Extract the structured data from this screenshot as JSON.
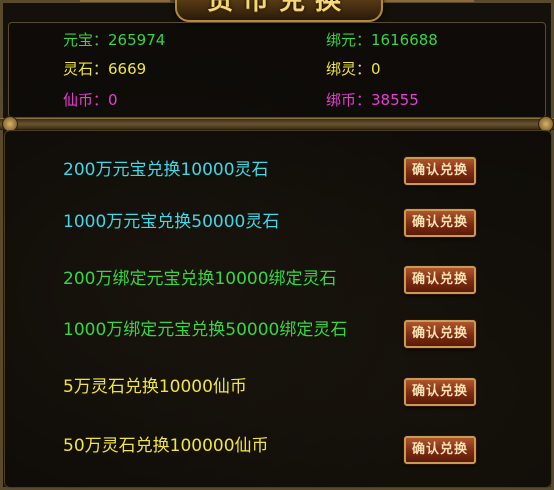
{
  "title": "货币兑换",
  "colors": {
    "cyan": "#3fd7e6",
    "green": "#36d640",
    "yellow": "#f1e43a",
    "magenta": "#e63ed2"
  },
  "currencies": [
    {
      "label": "元宝：",
      "value": "265974",
      "color": "#36d640"
    },
    {
      "label": "绑元：",
      "value": "1616688",
      "color": "#36d640"
    },
    {
      "label": "灵石：",
      "value": "6669",
      "color": "#f1e43a"
    },
    {
      "label": "绑灵：",
      "value": "0",
      "color": "#f1e43a"
    },
    {
      "label": "仙币：",
      "value": "0",
      "color": "#e63ed2"
    },
    {
      "label": "绑币：",
      "value": "38555",
      "color": "#e63ed2"
    }
  ],
  "exchanges": [
    {
      "text": "200万元宝兑换10000灵石",
      "color": "#3fd7e6",
      "button": "确认兑换"
    },
    {
      "text": "1000万元宝兑换50000灵石",
      "color": "#3fd7e6",
      "button": "确认兑换"
    },
    {
      "text": "200万绑定元宝兑换10000绑定灵石",
      "color": "#36d640",
      "button": "确认兑换"
    },
    {
      "text": "1000万绑定元宝兑换50000绑定灵石",
      "color": "#36d640",
      "button": "确认兑换"
    },
    {
      "text": "5万灵石兑换10000仙币",
      "color": "#f1e43a",
      "button": "确认兑换"
    },
    {
      "text": "50万灵石兑换100000仙币",
      "color": "#f1e43a",
      "button": "确认兑换"
    }
  ]
}
